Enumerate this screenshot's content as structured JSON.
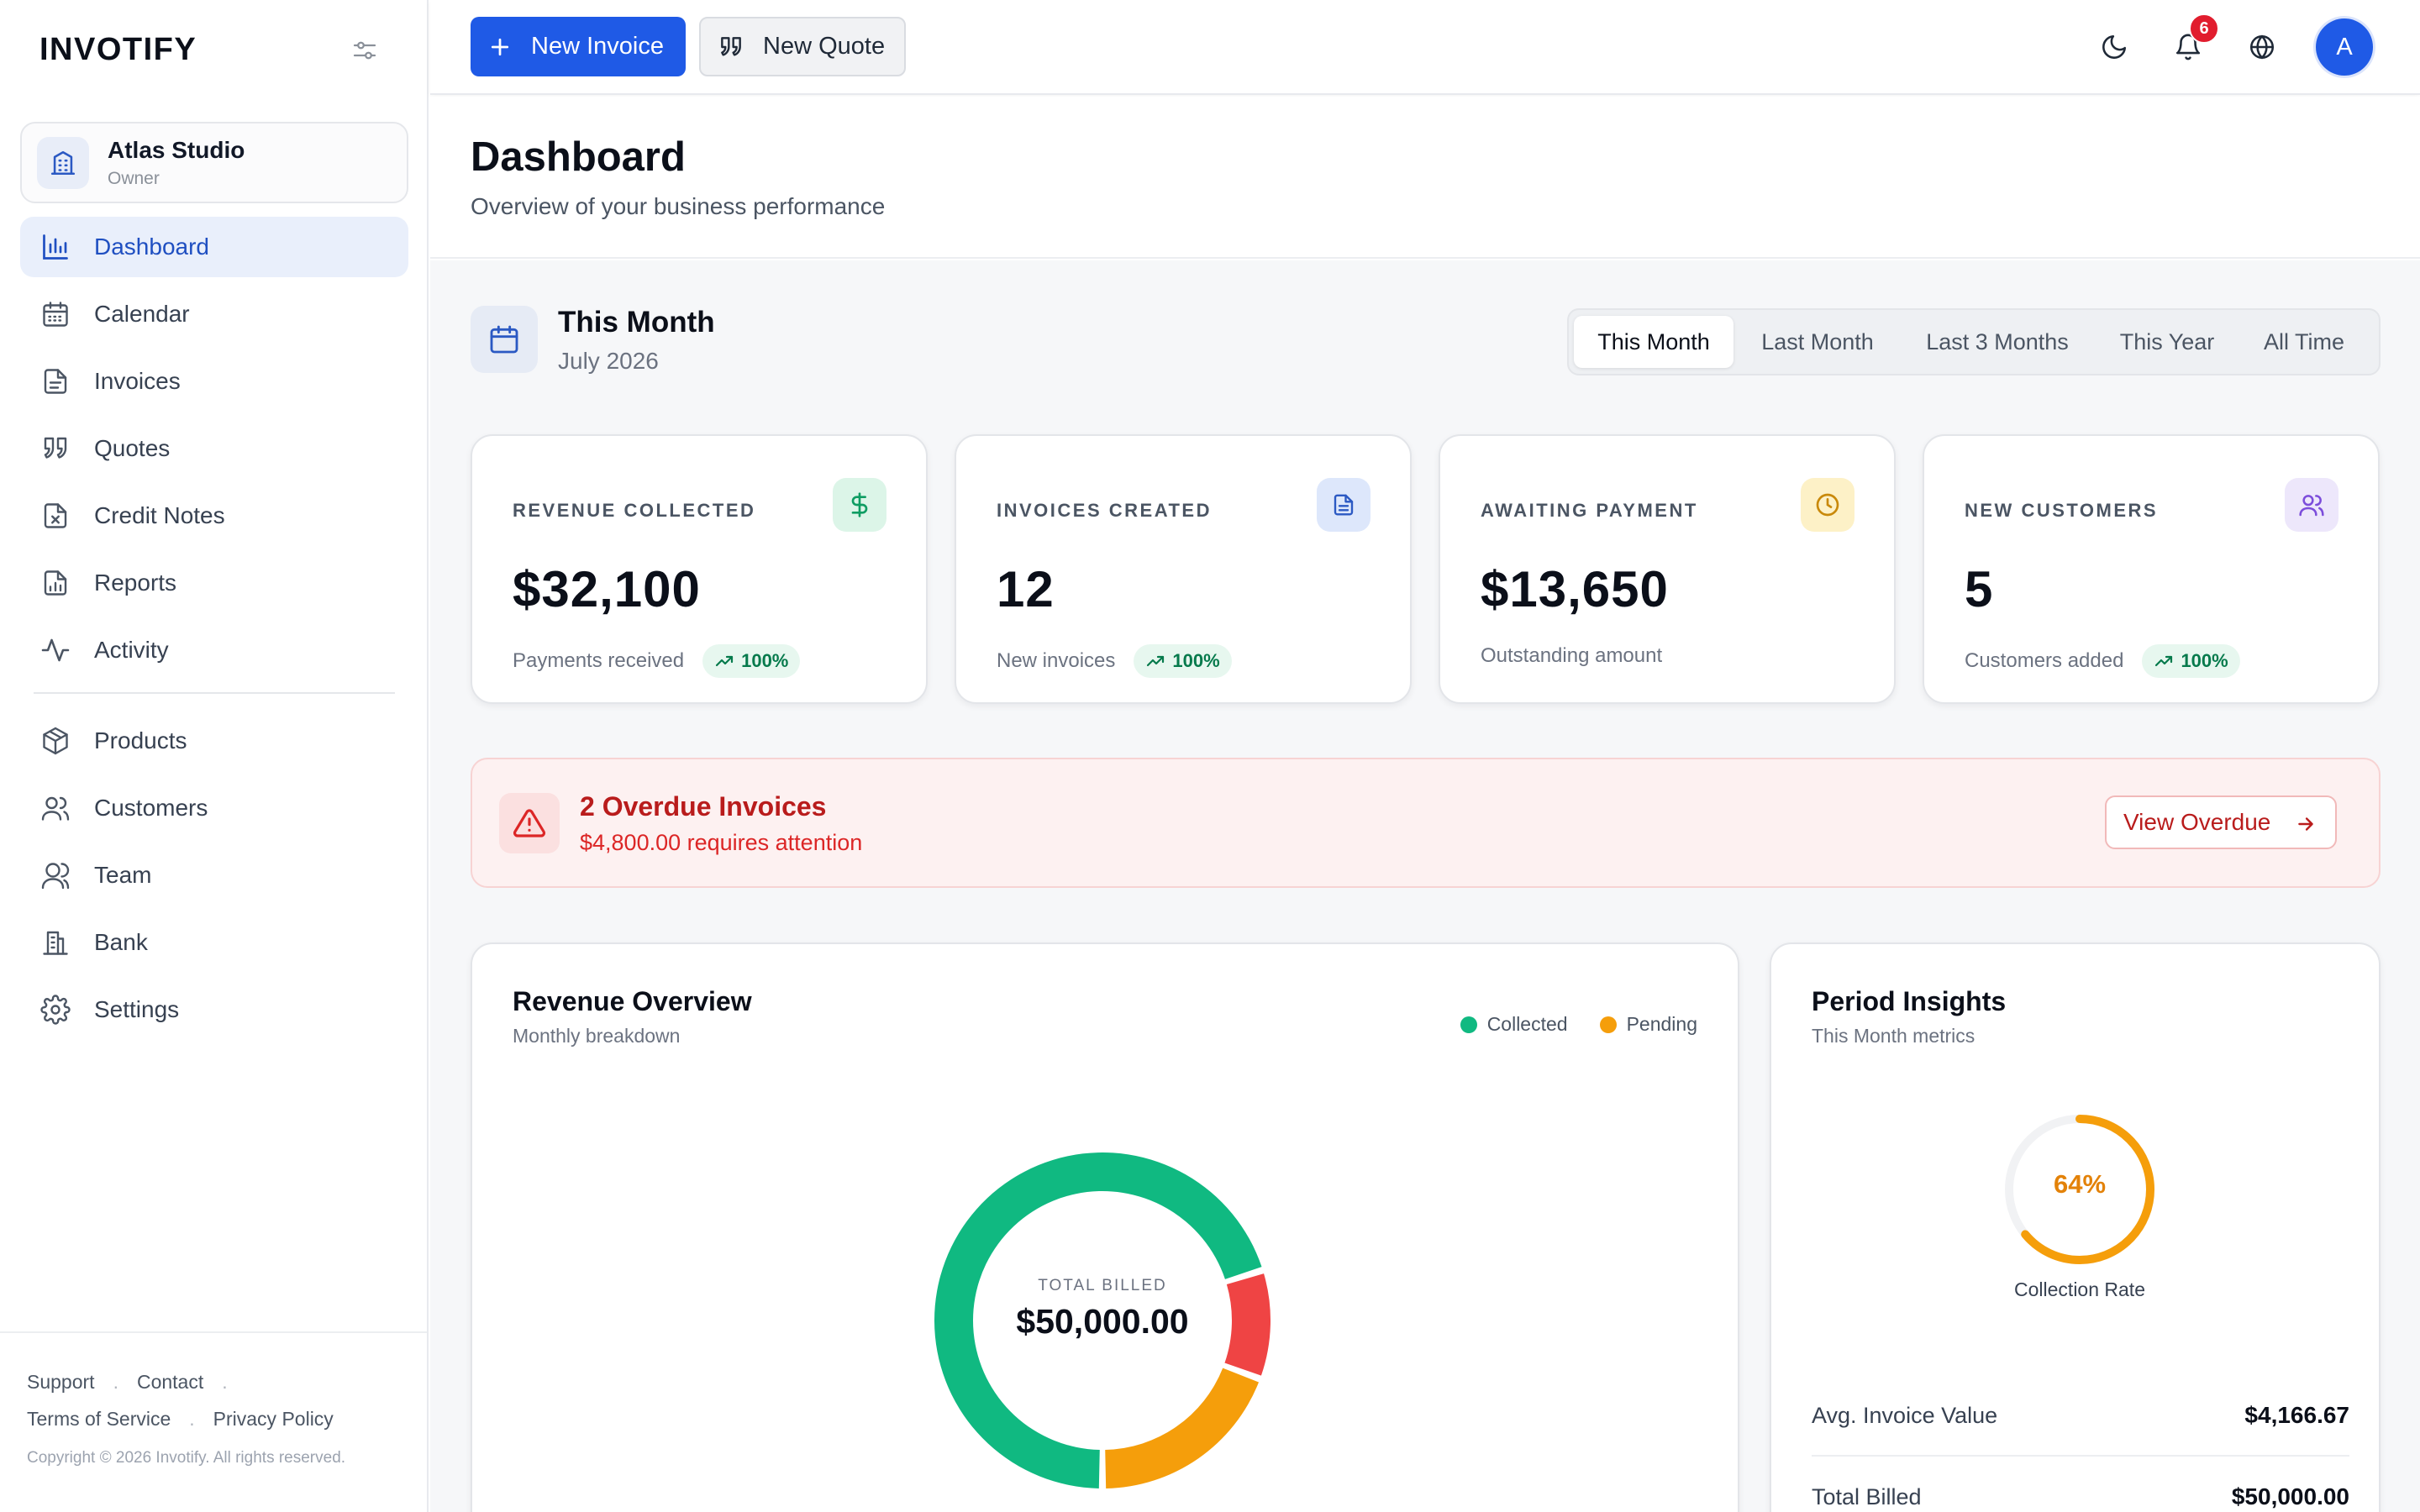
{
  "app": {
    "brand": "INVOTIFY"
  },
  "org": {
    "name": "Atlas Studio",
    "role": "Owner"
  },
  "nav": {
    "primary": [
      {
        "id": "dashboard",
        "label": "Dashboard",
        "icon": "chart-bar-icon",
        "active": true
      },
      {
        "id": "calendar",
        "label": "Calendar",
        "icon": "calendar-icon"
      },
      {
        "id": "invoices",
        "label": "Invoices",
        "icon": "file-text-icon"
      },
      {
        "id": "quotes",
        "label": "Quotes",
        "icon": "quote-icon"
      },
      {
        "id": "credit-notes",
        "label": "Credit Notes",
        "icon": "file-x-icon"
      },
      {
        "id": "reports",
        "label": "Reports",
        "icon": "file-chart-icon"
      },
      {
        "id": "activity",
        "label": "Activity",
        "icon": "activity-icon"
      }
    ],
    "secondary": [
      {
        "id": "products",
        "label": "Products",
        "icon": "package-icon"
      },
      {
        "id": "customers",
        "label": "Customers",
        "icon": "users-icon"
      },
      {
        "id": "team",
        "label": "Team",
        "icon": "user-group-icon"
      },
      {
        "id": "bank",
        "label": "Bank",
        "icon": "building-icon"
      },
      {
        "id": "settings",
        "label": "Settings",
        "icon": "gear-icon"
      }
    ]
  },
  "footer": {
    "support": "Support",
    "contact": "Contact",
    "terms": "Terms of Service",
    "privacy": "Privacy Policy",
    "copyright": "Copyright © 2026 Invotify. All rights reserved."
  },
  "topbar": {
    "new_invoice": "New Invoice",
    "new_quote": "New Quote",
    "notifications_count": "6",
    "avatar_initial": "A"
  },
  "page": {
    "title": "Dashboard",
    "subtitle": "Overview of your business performance"
  },
  "period": {
    "title": "This Month",
    "subtitle": "July 2026",
    "options": [
      "This Month",
      "Last Month",
      "Last 3 Months",
      "This Year",
      "All Time"
    ],
    "selected": "This Month"
  },
  "stats": [
    {
      "label": "REVENUE COLLECTED",
      "value": "$32,100",
      "note": "Payments received",
      "trend": "100%",
      "icon": "dollar-icon",
      "tint": "#dcf5e8",
      "color": "#0f9d63"
    },
    {
      "label": "INVOICES CREATED",
      "value": "12",
      "note": "New invoices",
      "trend": "100%",
      "icon": "document-icon",
      "tint": "#dde7fb",
      "color": "#2b59c3"
    },
    {
      "label": "AWAITING PAYMENT",
      "value": "$13,650",
      "note": "Outstanding amount",
      "trend": "",
      "icon": "clock-icon",
      "tint": "#fdf1c7",
      "color": "#c9890a"
    },
    {
      "label": "NEW CUSTOMERS",
      "value": "5",
      "note": "Customers added",
      "trend": "100%",
      "icon": "users-icon",
      "tint": "#ede7fb",
      "color": "#7c4ddb"
    }
  ],
  "alert": {
    "title": "2 Overdue Invoices",
    "subtitle": "$4,800.00 requires attention",
    "button": "View Overdue"
  },
  "revenue": {
    "title": "Revenue Overview",
    "subtitle": "Monthly breakdown",
    "legend": [
      {
        "name": "Collected",
        "color": "#10b981"
      },
      {
        "name": "Pending",
        "color": "#f59e0b"
      }
    ],
    "center_label": "TOTAL BILLED",
    "center_value": "$50,000.00"
  },
  "chart_data": {
    "type": "pie",
    "slices": [
      {
        "name": "Collected",
        "value": 32100,
        "color": "#10b981"
      },
      {
        "name": "",
        "value": 4800,
        "color": "#ef4444"
      },
      {
        "name": "Pending",
        "value": 8850,
        "color": "#f59e0b"
      }
    ],
    "total": 50000,
    "start_angle_deg": 90
  },
  "insights": {
    "title": "Period Insights",
    "subtitle": "This Month metrics",
    "collection_rate": 64,
    "collection_rate_text": "64%",
    "collection_label": "Collection Rate",
    "metrics": [
      {
        "label": "Avg. Invoice Value",
        "value": "$4,166.67"
      },
      {
        "label": "Total Billed",
        "value": "$50,000.00"
      }
    ]
  },
  "colors": {
    "accent": "#1f5ae6",
    "danger": "#dc2626",
    "gauge": "#f59e0b"
  }
}
